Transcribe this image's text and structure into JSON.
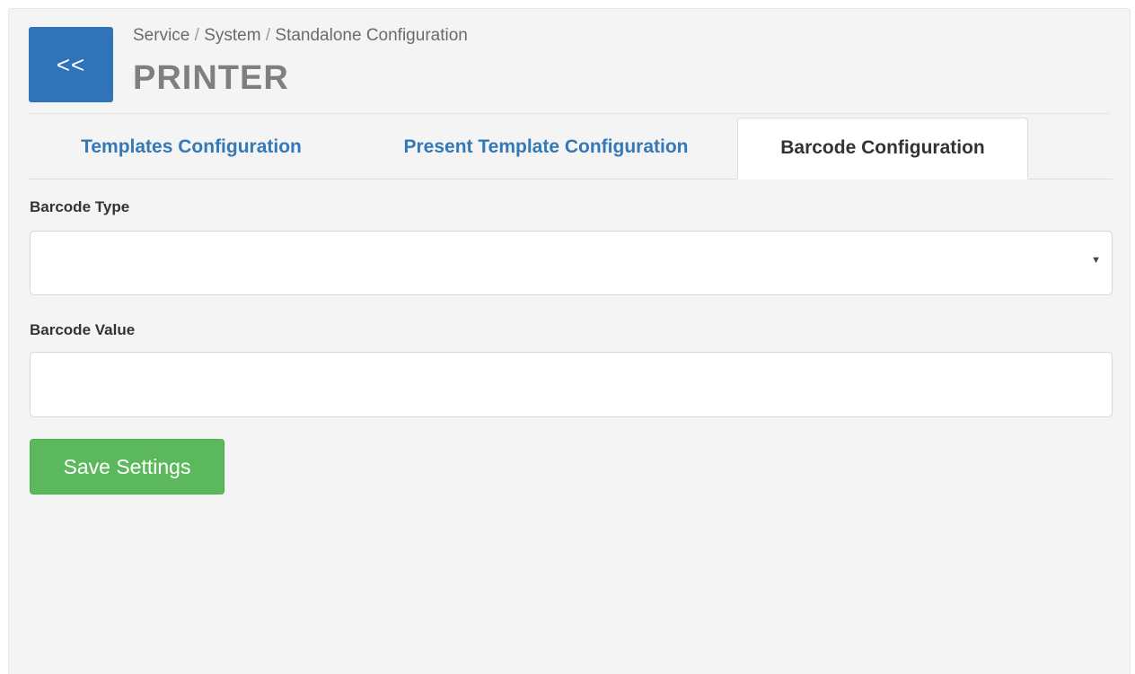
{
  "header": {
    "back_button_label": "<<",
    "breadcrumb": {
      "items": [
        "Service",
        "System",
        "Standalone Configuration"
      ],
      "separator": "/"
    },
    "title": "PRINTER"
  },
  "tabs": [
    {
      "label": "Templates Configuration",
      "active": false
    },
    {
      "label": "Present Template Configuration",
      "active": false
    },
    {
      "label": "Barcode Configuration",
      "active": true
    }
  ],
  "form": {
    "barcode_type": {
      "label": "Barcode Type",
      "value": "",
      "caret_icon": "caret-down-icon"
    },
    "barcode_value": {
      "label": "Barcode Value",
      "value": "",
      "placeholder": ""
    },
    "save_button_label": "Save Settings"
  },
  "colors": {
    "primary": "#2f73b8",
    "tab_link": "#3379b7",
    "success": "#5cb85c",
    "panel_bg": "#f4f4f4"
  }
}
